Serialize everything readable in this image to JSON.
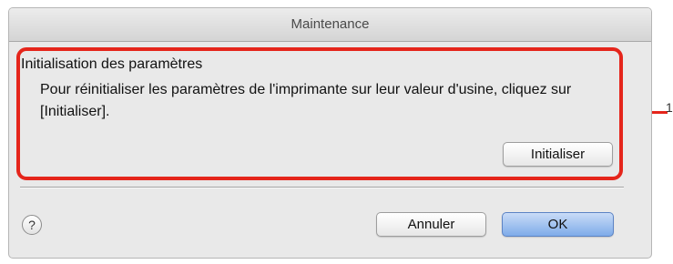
{
  "window": {
    "title": "Maintenance"
  },
  "settings": {
    "title": "Initialisation des paramètres",
    "description": "Pour réinitialiser les paramètres de l'imprimante sur leur valeur d'usine, cliquez sur [Initialiser].",
    "initialize_label": "Initialiser"
  },
  "footer": {
    "help_label": "?",
    "cancel_label": "Annuler",
    "ok_label": "OK"
  },
  "annotation": {
    "number": "1"
  },
  "colors": {
    "highlight": "#e5251b",
    "default_button": "#7eabe9"
  }
}
